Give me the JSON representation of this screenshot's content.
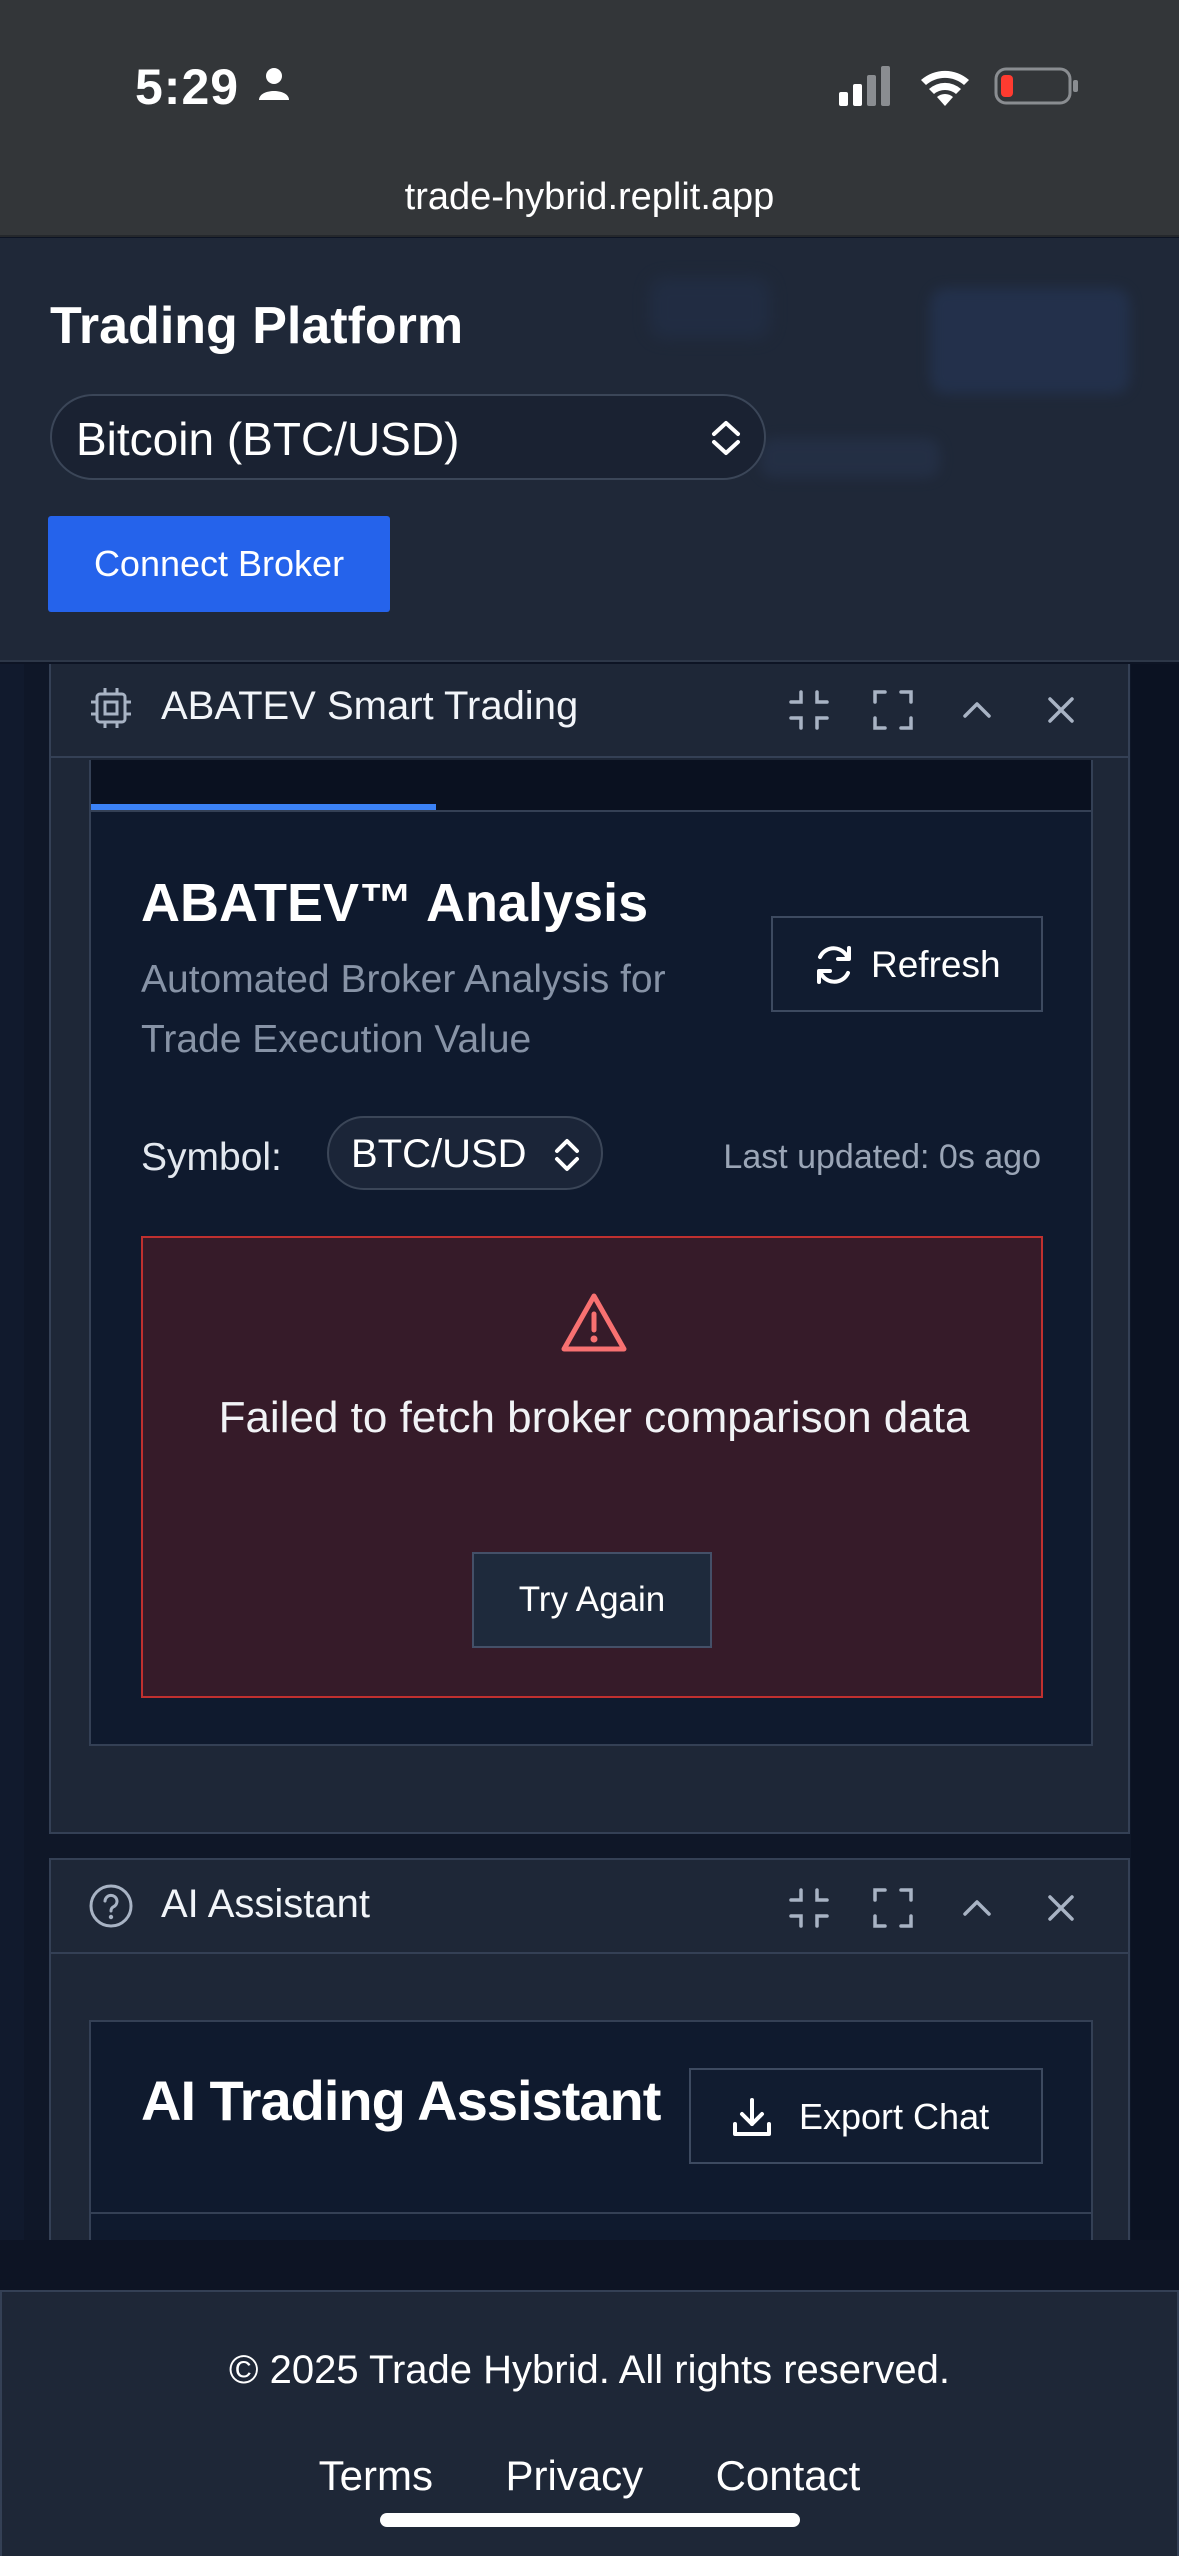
{
  "status_bar": {
    "time": "5:29",
    "icons": [
      "person-icon",
      "cellular-signal-icon",
      "wifi-icon",
      "battery-low-icon"
    ],
    "battery_color": "#ff3b30"
  },
  "browser": {
    "url": "trade-hybrid.replit.app"
  },
  "header": {
    "title": "Trading Platform",
    "pair_select": {
      "value": "Bitcoin (BTC/USD)"
    },
    "connect_label": "Connect Broker",
    "accent": "#2563eb"
  },
  "abatev_panel": {
    "title": "ABATEV Smart Trading",
    "icon": "cpu-chip-icon",
    "controls": [
      "minimize-icon",
      "maximize-icon",
      "collapse-icon",
      "close-icon"
    ],
    "analysis": {
      "title": "ABATEV™ Analysis",
      "subtitle": "Automated Broker Analysis for Trade Execution Value",
      "refresh_label": "Refresh",
      "symbol_label": "Symbol:",
      "symbol_value": "BTC/USD",
      "last_updated": "Last updated: 0s ago",
      "error": {
        "icon": "warning-triangle-icon",
        "message": "Failed to fetch broker comparison data",
        "retry_label": "Try Again",
        "color": "#c0302f"
      }
    }
  },
  "ai_panel": {
    "title": "AI Assistant",
    "icon": "help-circle-icon",
    "controls": [
      "minimize-icon",
      "maximize-icon",
      "collapse-icon",
      "close-icon"
    ],
    "inner_title": "AI Trading Assistant",
    "export_label": "Export Chat"
  },
  "footer": {
    "copyright": "© 2025 Trade Hybrid. All rights reserved.",
    "links": [
      "Terms",
      "Privacy",
      "Contact"
    ]
  }
}
